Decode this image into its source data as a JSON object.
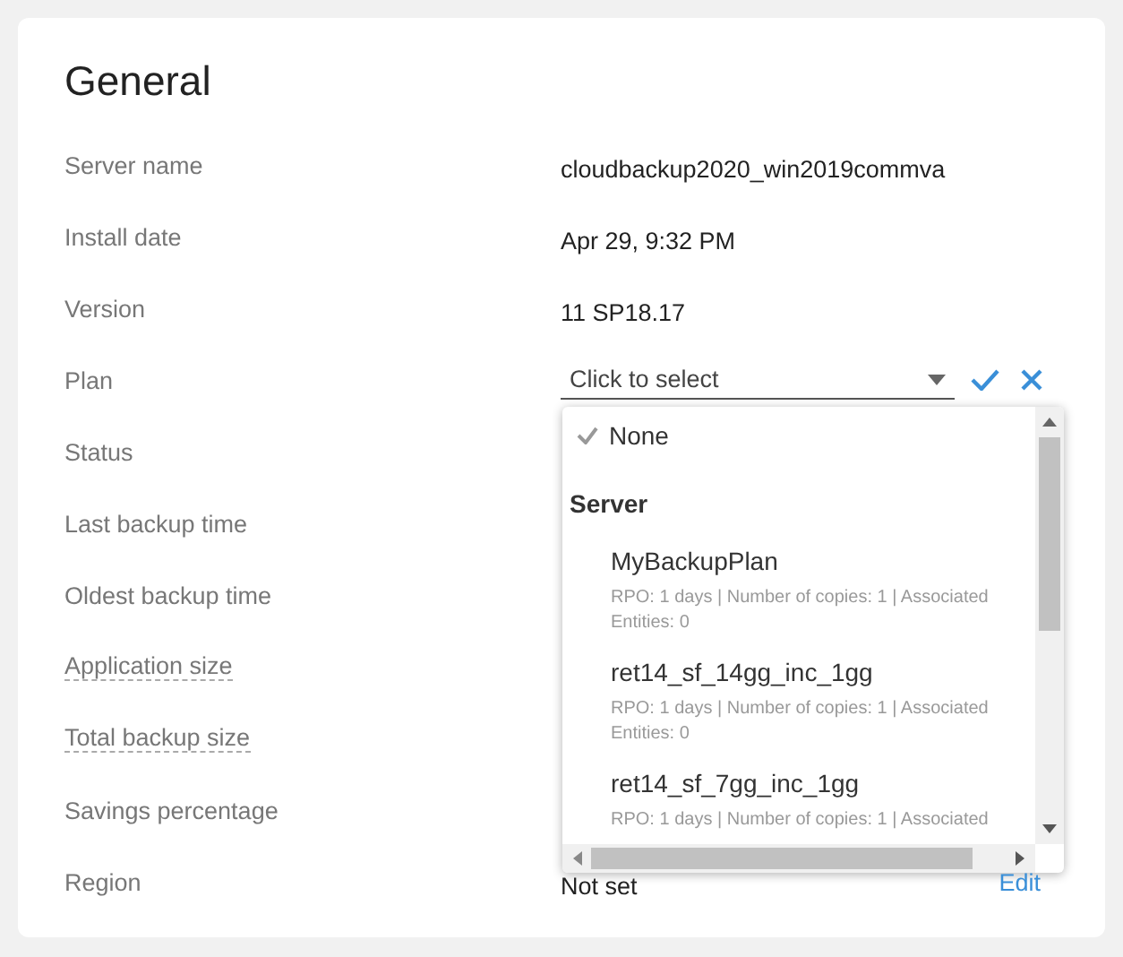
{
  "title": "General",
  "rows": [
    {
      "label": "Server name",
      "value": "cloudbackup2020_win2019commva",
      "dashed": false
    },
    {
      "label": "Install date",
      "value": "Apr 29, 9:32 PM",
      "dashed": false
    },
    {
      "label": "Version",
      "value": "11 SP18.17",
      "dashed": false
    },
    {
      "label": "Plan",
      "kind": "select",
      "dashed": false,
      "placeholder": "Click to select"
    },
    {
      "label": "Status",
      "dashed": false
    },
    {
      "label": "Last backup time",
      "dashed": false
    },
    {
      "label": "Oldest backup time",
      "dashed": false
    },
    {
      "label": "Application size",
      "dashed": true
    },
    {
      "label": "Total backup size",
      "dashed": true
    },
    {
      "label": "Savings percentage",
      "dashed": false
    },
    {
      "label": "Region",
      "value": "Not set",
      "action": "Edit",
      "dashed": false
    }
  ],
  "dropdown": {
    "options": [
      {
        "label": "None",
        "selected": true
      }
    ],
    "group": "Server",
    "plans": [
      {
        "name": "MyBackupPlan",
        "description": "RPO: 1 days | Number of copies: 1 | Associated Entities: 0",
        "selected": false
      },
      {
        "name": "ret14_sf_14gg_inc_1gg",
        "description": "RPO: 1 days | Number of copies: 1 | Associated Entities: 0",
        "selected": false
      },
      {
        "name": "ret14_sf_7gg_inc_1gg",
        "description": "RPO: 1 days | Number of copies: 1 | Associated",
        "selected": false
      }
    ]
  }
}
